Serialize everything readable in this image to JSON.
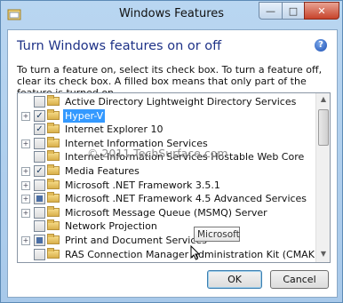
{
  "window": {
    "title": "Windows Features",
    "minimize_glyph": "—",
    "maximize_glyph": "□",
    "close_glyph": "✕"
  },
  "heading": "Turn Windows features on or off",
  "help_glyph": "?",
  "description": "To turn a feature on, select its check box. To turn a feature off, clear its check box. A filled box means that only part of the feature is turned on.",
  "features": [
    {
      "label": "Active Directory Lightweight Directory Services",
      "state": "unchecked",
      "expandable": false,
      "selected": false
    },
    {
      "label": "Hyper-V",
      "state": "checked",
      "expandable": true,
      "selected": true
    },
    {
      "label": "Internet Explorer 10",
      "state": "checked",
      "expandable": false,
      "selected": false
    },
    {
      "label": "Internet Information Services",
      "state": "unchecked",
      "expandable": true,
      "selected": false
    },
    {
      "label": "Internet Information Services Hostable Web Core",
      "state": "unchecked",
      "expandable": false,
      "selected": false
    },
    {
      "label": "Media Features",
      "state": "checked",
      "expandable": true,
      "selected": false
    },
    {
      "label": "Microsoft .NET Framework 3.5.1",
      "state": "unchecked",
      "expandable": true,
      "selected": false
    },
    {
      "label": "Microsoft .NET Framework 4.5 Advanced Services",
      "state": "partial",
      "expandable": true,
      "selected": false
    },
    {
      "label": "Microsoft Message Queue (MSMQ) Server",
      "state": "unchecked",
      "expandable": true,
      "selected": false
    },
    {
      "label": "Network Projection",
      "state": "unchecked",
      "expandable": false,
      "selected": false
    },
    {
      "label": "Print and Document Services",
      "state": "partial",
      "expandable": true,
      "selected": false
    },
    {
      "label": "RAS Connection Manager Administration Kit (CMAK)",
      "state": "unchecked",
      "expandable": false,
      "selected": false
    }
  ],
  "tooltip": "Microsoft",
  "watermark": "© 2011 TechSurface.com",
  "buttons": {
    "ok": "OK",
    "cancel": "Cancel"
  },
  "expander_glyph": "+",
  "check_glyph": "✓",
  "scroll_up_glyph": "▲",
  "scroll_down_glyph": "▼",
  "colors": {
    "heading": "#1e3287",
    "selection": "#3399ff",
    "frame": "#a8c9ea"
  }
}
